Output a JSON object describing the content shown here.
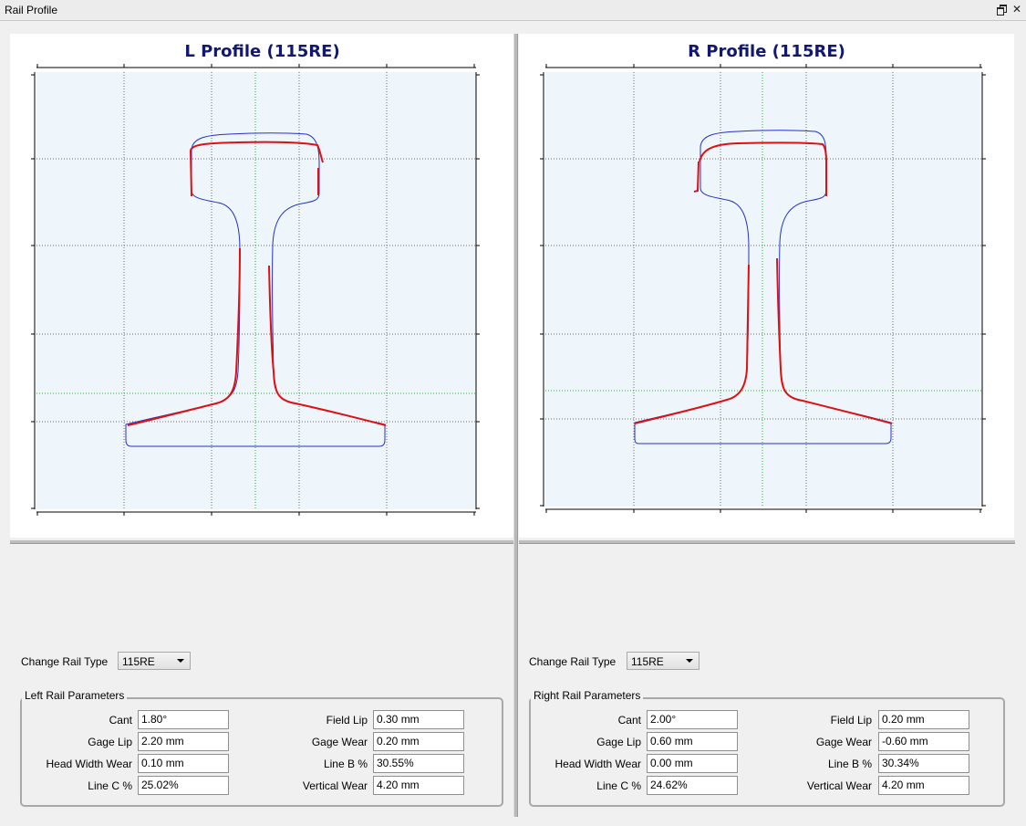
{
  "window": {
    "title": "Rail Profile"
  },
  "colors": {
    "plot_bg": "#eef6fc",
    "reference_profile": "#2331c8",
    "measured_profile": "#e01010",
    "grid": "#6c6c6c",
    "center_lines": "#19b619",
    "title": "#12186e"
  },
  "left_chart": {
    "title": "L Profile (115RE)"
  },
  "right_chart": {
    "title": "R Profile (115RE)"
  },
  "left_panel": {
    "change_label": "Change Rail Type",
    "rail_type": "115RE",
    "group_title": "Left Rail Parameters",
    "params": [
      {
        "label": "Cant",
        "value": "1.80°"
      },
      {
        "label": "Gage Lip",
        "value": "2.20 mm"
      },
      {
        "label": "Head Width Wear",
        "value": "0.10 mm"
      },
      {
        "label": "Line C %",
        "value": "25.02%"
      },
      {
        "label": "Field Lip",
        "value": "0.30 mm"
      },
      {
        "label": "Gage Wear",
        "value": "0.20 mm"
      },
      {
        "label": "Line B %",
        "value": "30.55%"
      },
      {
        "label": "Vertical Wear",
        "value": "4.20 mm"
      }
    ]
  },
  "right_panel": {
    "change_label": "Change Rail Type",
    "rail_type": "115RE",
    "group_title": "Right Rail Parameters",
    "params": [
      {
        "label": "Cant",
        "value": "2.00°"
      },
      {
        "label": "Gage Lip",
        "value": "0.60 mm"
      },
      {
        "label": "Head Width Wear",
        "value": "0.00 mm"
      },
      {
        "label": "Line C %",
        "value": "24.62%"
      },
      {
        "label": "Field Lip",
        "value": "0.20 mm"
      },
      {
        "label": "Gage Wear",
        "value": "-0.60 mm"
      },
      {
        "label": "Line B %",
        "value": "30.34%"
      },
      {
        "label": "Vertical Wear",
        "value": "4.20 mm"
      }
    ]
  }
}
